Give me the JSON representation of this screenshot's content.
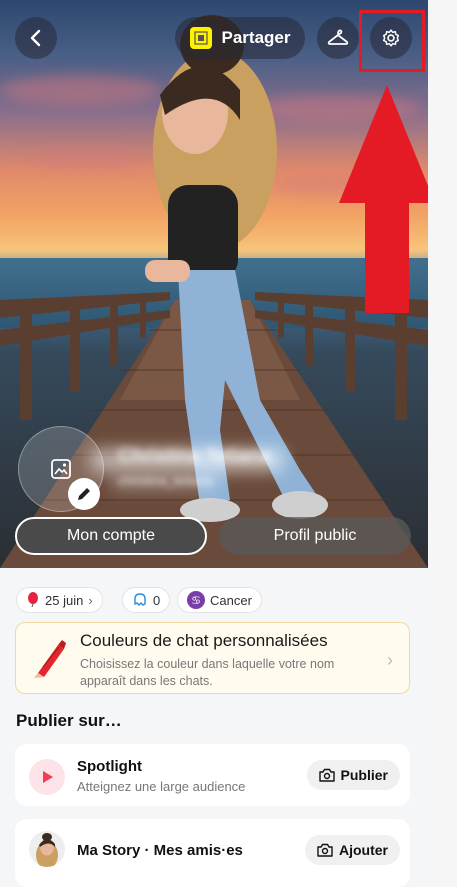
{
  "header": {
    "share_label": "Partager"
  },
  "profile": {
    "display_name": "Christina Tetiana",
    "username": "christina_tetiana",
    "account_button": "Mon compte",
    "public_profile_button": "Profil public"
  },
  "chips": {
    "birthday": "25 juin",
    "friends_count": "0",
    "zodiac": "Cancer"
  },
  "promo": {
    "title": "Couleurs de chat personnalisées",
    "description": "Choisissez la couleur dans laquelle votre nom apparaît dans les chats."
  },
  "publish": {
    "heading": "Publier sur…",
    "spotlight_title": "Spotlight",
    "spotlight_sub": "Atteignez une large audience",
    "spotlight_action": "Publier",
    "story_title": "Ma Story · Mes amis·es",
    "story_action": "Ajouter"
  },
  "colors": {
    "annotation_red": "#e41b24",
    "share_qr_yellow": "#fff200",
    "spotlight_red": "#f23c57"
  }
}
